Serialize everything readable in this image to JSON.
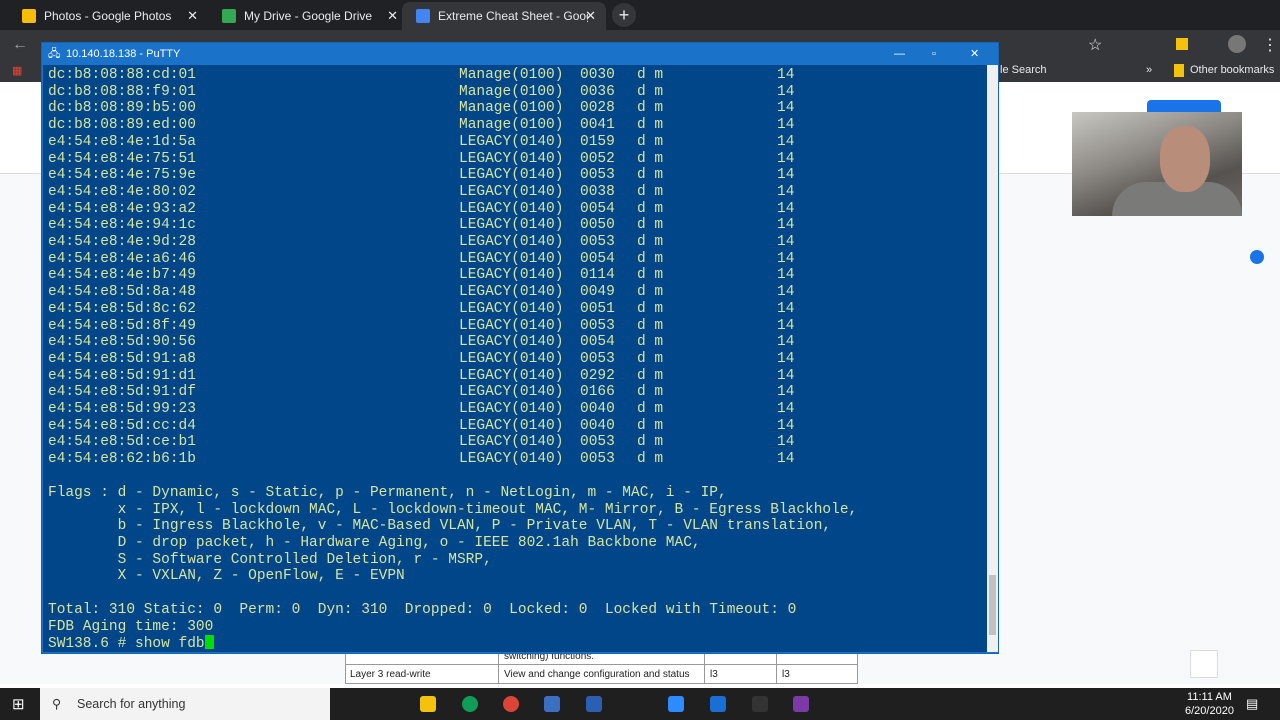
{
  "browser": {
    "tabs": [
      {
        "title": "Photos - Google Photos",
        "color": "#fbbc04"
      },
      {
        "title": "My Drive - Google Drive",
        "color": "#34a853"
      },
      {
        "title": "Extreme Cheat Sheet - Google Di",
        "color": "#4285f4",
        "active": true
      }
    ],
    "bookmarks": {
      "partial": "le Search",
      "overflow": "»",
      "other": "Other bookmarks"
    }
  },
  "doc": {
    "table": [
      {
        "col1": "",
        "col2": "switching) functions.",
        "col3": "",
        "col4": ""
      },
      {
        "col1": "Layer 3 read-write",
        "col2": "View and change configuration and status",
        "col3": "l3",
        "col4": "l3"
      }
    ]
  },
  "putty": {
    "title": "10.140.18.138 - PuTTY",
    "rows": [
      [
        "dc:b8:08:88:cd:01",
        "Manage(0100)",
        "0030",
        "d m",
        "14"
      ],
      [
        "dc:b8:08:88:f9:01",
        "Manage(0100)",
        "0036",
        "d m",
        "14"
      ],
      [
        "dc:b8:08:89:b5:00",
        "Manage(0100)",
        "0028",
        "d m",
        "14"
      ],
      [
        "dc:b8:08:89:ed:00",
        "Manage(0100)",
        "0041",
        "d m",
        "14"
      ],
      [
        "e4:54:e8:4e:1d:5a",
        "LEGACY(0140)",
        "0159",
        "d m",
        "14"
      ],
      [
        "e4:54:e8:4e:75:51",
        "LEGACY(0140)",
        "0052",
        "d m",
        "14"
      ],
      [
        "e4:54:e8:4e:75:9e",
        "LEGACY(0140)",
        "0053",
        "d m",
        "14"
      ],
      [
        "e4:54:e8:4e:80:02",
        "LEGACY(0140)",
        "0038",
        "d m",
        "14"
      ],
      [
        "e4:54:e8:4e:93:a2",
        "LEGACY(0140)",
        "0054",
        "d m",
        "14"
      ],
      [
        "e4:54:e8:4e:94:1c",
        "LEGACY(0140)",
        "0050",
        "d m",
        "14"
      ],
      [
        "e4:54:e8:4e:9d:28",
        "LEGACY(0140)",
        "0053",
        "d m",
        "14"
      ],
      [
        "e4:54:e8:4e:a6:46",
        "LEGACY(0140)",
        "0054",
        "d m",
        "14"
      ],
      [
        "e4:54:e8:4e:b7:49",
        "LEGACY(0140)",
        "0114",
        "d m",
        "14"
      ],
      [
        "e4:54:e8:5d:8a:48",
        "LEGACY(0140)",
        "0049",
        "d m",
        "14"
      ],
      [
        "e4:54:e8:5d:8c:62",
        "LEGACY(0140)",
        "0051",
        "d m",
        "14"
      ],
      [
        "e4:54:e8:5d:8f:49",
        "LEGACY(0140)",
        "0053",
        "d m",
        "14"
      ],
      [
        "e4:54:e8:5d:90:56",
        "LEGACY(0140)",
        "0054",
        "d m",
        "14"
      ],
      [
        "e4:54:e8:5d:91:a8",
        "LEGACY(0140)",
        "0053",
        "d m",
        "14"
      ],
      [
        "e4:54:e8:5d:91:d1",
        "LEGACY(0140)",
        "0292",
        "d m",
        "14"
      ],
      [
        "e4:54:e8:5d:91:df",
        "LEGACY(0140)",
        "0166",
        "d m",
        "14"
      ],
      [
        "e4:54:e8:5d:99:23",
        "LEGACY(0140)",
        "0040",
        "d m",
        "14"
      ],
      [
        "e4:54:e8:5d:cc:d4",
        "LEGACY(0140)",
        "0040",
        "d m",
        "14"
      ],
      [
        "e4:54:e8:5d:ce:b1",
        "LEGACY(0140)",
        "0053",
        "d m",
        "14"
      ],
      [
        "e4:54:e8:62:b6:1b",
        "LEGACY(0140)",
        "0053",
        "d m",
        "14"
      ]
    ],
    "flags": [
      "Flags : d - Dynamic, s - Static, p - Permanent, n - NetLogin, m - MAC, i - IP,",
      "        x - IPX, l - lockdown MAC, L - lockdown-timeout MAC, M- Mirror, B - Egress Blackhole,",
      "        b - Ingress Blackhole, v - MAC-Based VLAN, P - Private VLAN, T - VLAN translation,",
      "        D - drop packet, h - Hardware Aging, o - IEEE 802.1ah Backbone MAC,",
      "        S - Software Controlled Deletion, r - MSRP,",
      "        X - VXLAN, Z - OpenFlow, E - EVPN"
    ],
    "total": "Total: 310 Static: 0  Perm: 0  Dyn: 310  Dropped: 0  Locked: 0  Locked with Timeout: 0",
    "aging": "FDB Aging time: 300",
    "prompt": "SW138.6 # show fdb"
  },
  "taskbar": {
    "search_placeholder": "Search for anything",
    "time": "11:11 AM",
    "date": "6/20/2020",
    "notifications": "1"
  }
}
